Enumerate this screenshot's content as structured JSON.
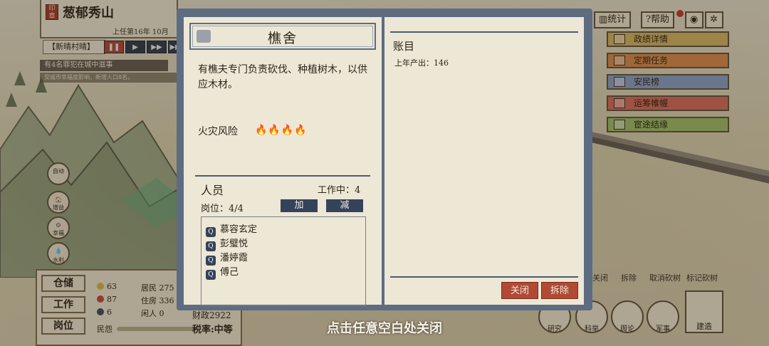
{
  "city": {
    "seal": "印章",
    "name": "葱郁秀山",
    "term": "上任第16年 10月",
    "weather": "【新晴村晴】",
    "speed_controls": [
      "❚❚",
      "▶",
      "▶▶",
      "▶▶▶"
    ],
    "notice1": "有4名罪犯在城中滋事",
    "notice2": "受城市幸福度影响，新增人口8名。"
  },
  "left_buttons": [
    {
      "label": "自动建造",
      "text": "自动"
    },
    {
      "label": "增益",
      "text": "🏠"
    },
    {
      "label": "幸福",
      "text": "☺"
    },
    {
      "label": "水利",
      "text": "💧"
    }
  ],
  "stats": {
    "buttons": [
      "仓储",
      "工作",
      "岗位"
    ],
    "happiness": "63",
    "health": "87",
    "crime": "6",
    "residents": "居民 275",
    "housing": "住房 336",
    "idle": "闲人 0",
    "opinion_label": "民怨",
    "finance": "财政2922",
    "tax": "税率:中等"
  },
  "top_right": {
    "stats_btn": "统计",
    "help_btn": "帮助",
    "view_icon": "eye-icon",
    "settings_icon": "gear-icon"
  },
  "side_menu": [
    {
      "label": "政绩详情",
      "color": "#d4b460"
    },
    {
      "label": "定期任务",
      "color": "#d98b4b"
    },
    {
      "label": "安民榜",
      "color": "#8aa0c6"
    },
    {
      "label": "运筹帷幄",
      "color": "#d86a5a"
    },
    {
      "label": "宦途结缘",
      "color": "#9fbf68"
    }
  ],
  "tool_labels": [
    "关闭",
    "拆除",
    "取消砍树",
    "标记砍树"
  ],
  "bottom_tools": [
    {
      "label": "研究"
    },
    {
      "label": "科举"
    },
    {
      "label": "舆论"
    },
    {
      "label": "军事"
    }
  ],
  "build_label": "建造",
  "modal": {
    "title": "樵舍",
    "description": "有樵夫专门负责砍伐、种植树木，以供应木材。",
    "fire_risk_label": "火灾风险",
    "fire_risk_icons": "🔥🔥🔥🔥",
    "staff_title": "人员",
    "working": "工作中：4",
    "posts": "岗位：4/4",
    "add_btn": "加",
    "remove_btn": "减",
    "staff": [
      "慕容玄定",
      "彭璧悦",
      "潘婷霞",
      "傅己"
    ],
    "ledger_title": "账目",
    "ledger_lines": [
      "上年产出：146"
    ],
    "close_btn": "关闭",
    "demolish_btn": "拆除"
  },
  "hint": "点击任意空白处关闭"
}
